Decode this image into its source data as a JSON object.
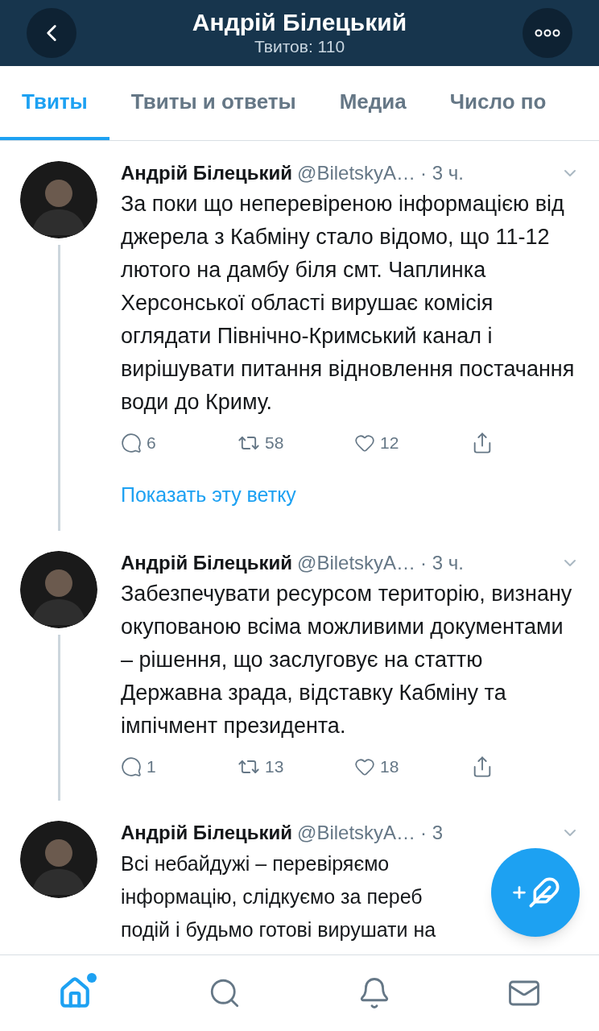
{
  "header": {
    "title": "Андрій Білецький",
    "subtitle": "Твитов: 110"
  },
  "tabs": [
    {
      "label": "Твиты",
      "selected": true
    },
    {
      "label": "Твиты и ответы",
      "selected": false
    },
    {
      "label": "Медиа",
      "selected": false
    },
    {
      "label": "Число по",
      "selected": false
    }
  ],
  "tweets": [
    {
      "name": "Андрій Білецький",
      "handle": "@BiletskyA…",
      "time": "· 3 ч.",
      "text": "За поки що неперевіреною інформацією від джерела з Кабміну стало відомо, що 11-12 лютого на дамбу біля смт. Чаплинка Херсонської області вирушає комісія оглядати Північно-Кримський канал і вирішувати питання відновлення постачання води до Криму.",
      "replies": "6",
      "retweets": "58",
      "likes": "12",
      "thread_link": "Показать эту ветку"
    },
    {
      "name": "Андрій Білецький",
      "handle": "@BiletskyA…",
      "time": "· 3 ч.",
      "text": "Забезпечувати ресурсом територію, визнану окупованою всіма можливими документами – рішення, що заслуговує на статтю Державна зрада, відставку Кабміну та імпічмент президента.",
      "replies": "1",
      "retweets": "13",
      "likes": "18"
    },
    {
      "name": "Андрій Білецький",
      "handle": "@BiletskyA…",
      "time": "· 3",
      "lines": [
        "Всі небайдужі – перевіряємо",
        "інформацію, слідкуємо за переб",
        "подій і будьмо готові вирушати на"
      ]
    }
  ],
  "bottom_nav": [
    {
      "kind": "home",
      "selected": true,
      "has_new": true
    },
    {
      "kind": "search",
      "selected": false,
      "has_new": false
    },
    {
      "kind": "notifications",
      "selected": false,
      "has_new": false
    },
    {
      "kind": "messages",
      "selected": false,
      "has_new": false
    }
  ]
}
